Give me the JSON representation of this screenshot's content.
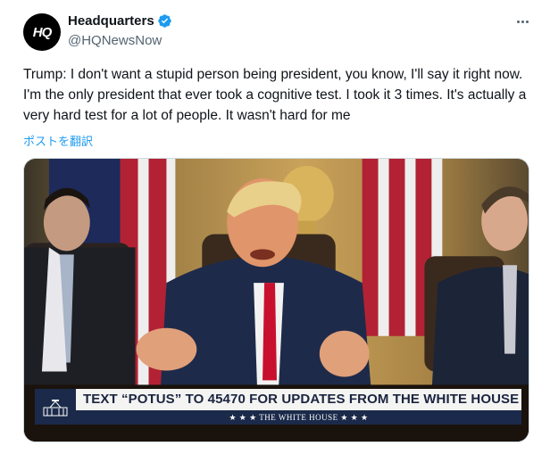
{
  "author": {
    "avatar_text": "HQ",
    "display_name": "Headquarters",
    "handle": "@HQNewsNow",
    "verified_icon": "verified-badge-icon",
    "verified_color": "#1d9bf0"
  },
  "more_icon": "more-horizontal-icon",
  "tweet": {
    "text": "Trump: I don't want a stupid person being president, you know, I'll say it right now. I'm the only president that ever took a cognitive test. I took it 3 times. It's actually a very hard test for a lot of people. It wasn't hard for me",
    "translate_label": "ポストを翻訳"
  },
  "media": {
    "banner_text": "TEXT “POTUS” TO 45470 FOR UPDATES FROM THE WHITE HOUSE",
    "banner_sub_text": "★ ★ ★   THE WHITE HOUSE   ★ ★ ★",
    "banner_color": "#1b2a4a"
  }
}
